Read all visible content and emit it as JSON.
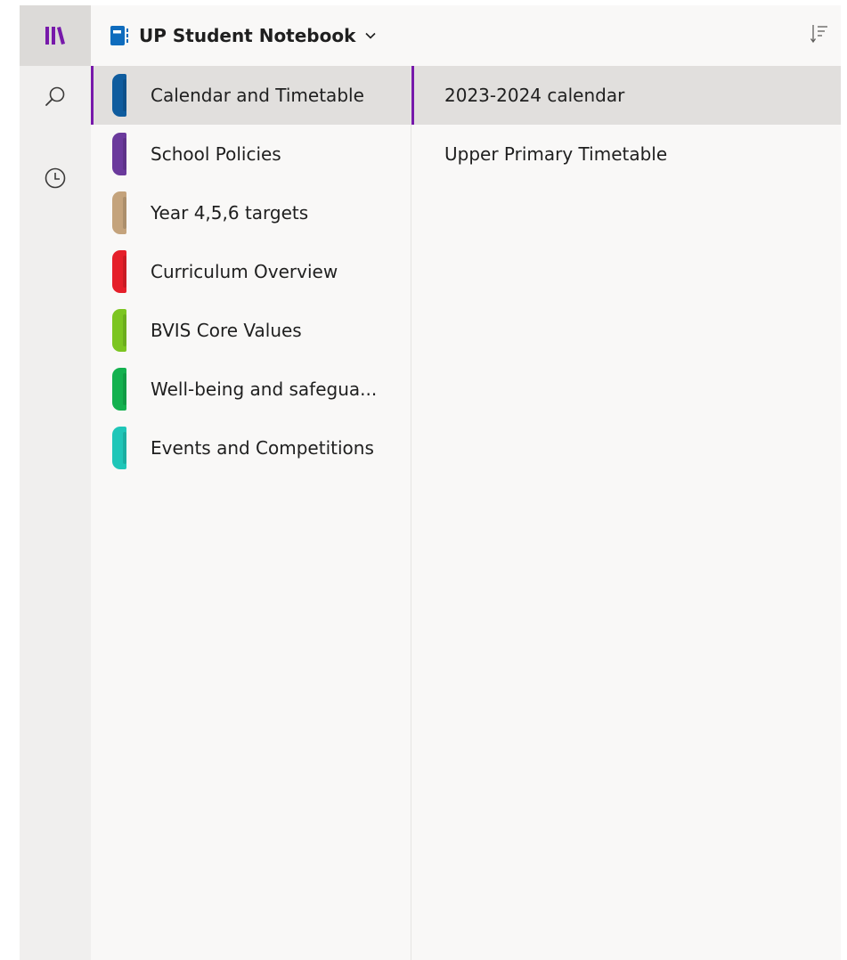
{
  "notebook": {
    "title": "UP Student Notebook"
  },
  "nav": {
    "items": [
      {
        "name": "notebooks",
        "icon": "notebooks-library-icon",
        "active": true
      },
      {
        "name": "search",
        "icon": "search-icon",
        "active": false
      },
      {
        "name": "recent",
        "icon": "clock-icon",
        "active": false
      }
    ]
  },
  "sections": [
    {
      "label": "Calendar and Timetable",
      "color": "#0f5c9e",
      "selected": true
    },
    {
      "label": "School Policies",
      "color": "#6b3a9c",
      "selected": false
    },
    {
      "label": "Year 4,5,6 targets",
      "color": "#c4a37c",
      "selected": false
    },
    {
      "label": "Curriculum Overview",
      "color": "#e51f2a",
      "selected": false
    },
    {
      "label": "BVIS Core Values",
      "color": "#7cc521",
      "selected": false
    },
    {
      "label": "Well-being and safegua...",
      "color": "#13b14f",
      "selected": false
    },
    {
      "label": "Events and Competitions",
      "color": "#1fc6b8",
      "selected": false
    }
  ],
  "pages": [
    {
      "label": "2023-2024 calendar",
      "selected": true
    },
    {
      "label": "Upper Primary Timetable",
      "selected": false
    }
  ],
  "colors": {
    "accent": "#7719aa",
    "notebook_icon": "#0f6cbd"
  }
}
